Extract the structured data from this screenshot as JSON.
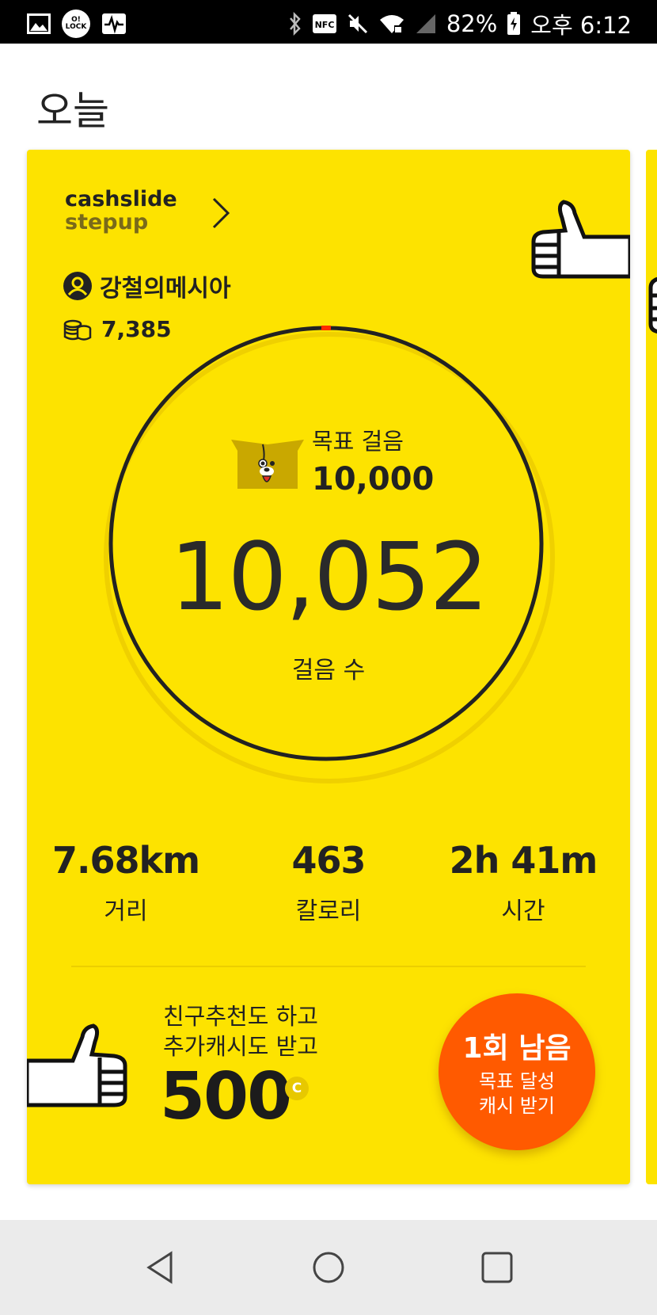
{
  "status_bar": {
    "battery": "82%",
    "time": "오후 6:12",
    "lock_badge_top": "O!",
    "lock_badge_bottom": "LOCK",
    "nfc": "NFC",
    "icons": [
      "gallery-icon",
      "olock-icon",
      "activity-icon",
      "bluetooth-icon",
      "nfc-icon",
      "mute-icon",
      "wifi-icon",
      "signal-icon",
      "battery-icon"
    ]
  },
  "header": {
    "title": "오늘"
  },
  "card": {
    "brand_line1": "cashslide",
    "brand_line2": "stepup",
    "user_name": "강철의메시아",
    "coins": "7,385",
    "goal_label": "목표 걸음",
    "goal_value": "10,000",
    "step_count": "10,052",
    "step_label": "걸음 수",
    "stats": [
      {
        "value": "7.68km",
        "label": "거리"
      },
      {
        "value": "463",
        "label": "칼로리"
      },
      {
        "value": "2h 41m",
        "label": "시간"
      }
    ],
    "promo_line1": "친구추천도 하고",
    "promo_line2": "추가캐시도 받고",
    "promo_amount": "500",
    "coin_symbol": "C",
    "reward_count": "1회 남음",
    "reward_line1": "목표 달성",
    "reward_line2": "캐시 받기"
  },
  "colors": {
    "card": "#fde300",
    "reward": "#ff5a00",
    "ring": "#222222",
    "progress_marker": "#ff2a00"
  }
}
